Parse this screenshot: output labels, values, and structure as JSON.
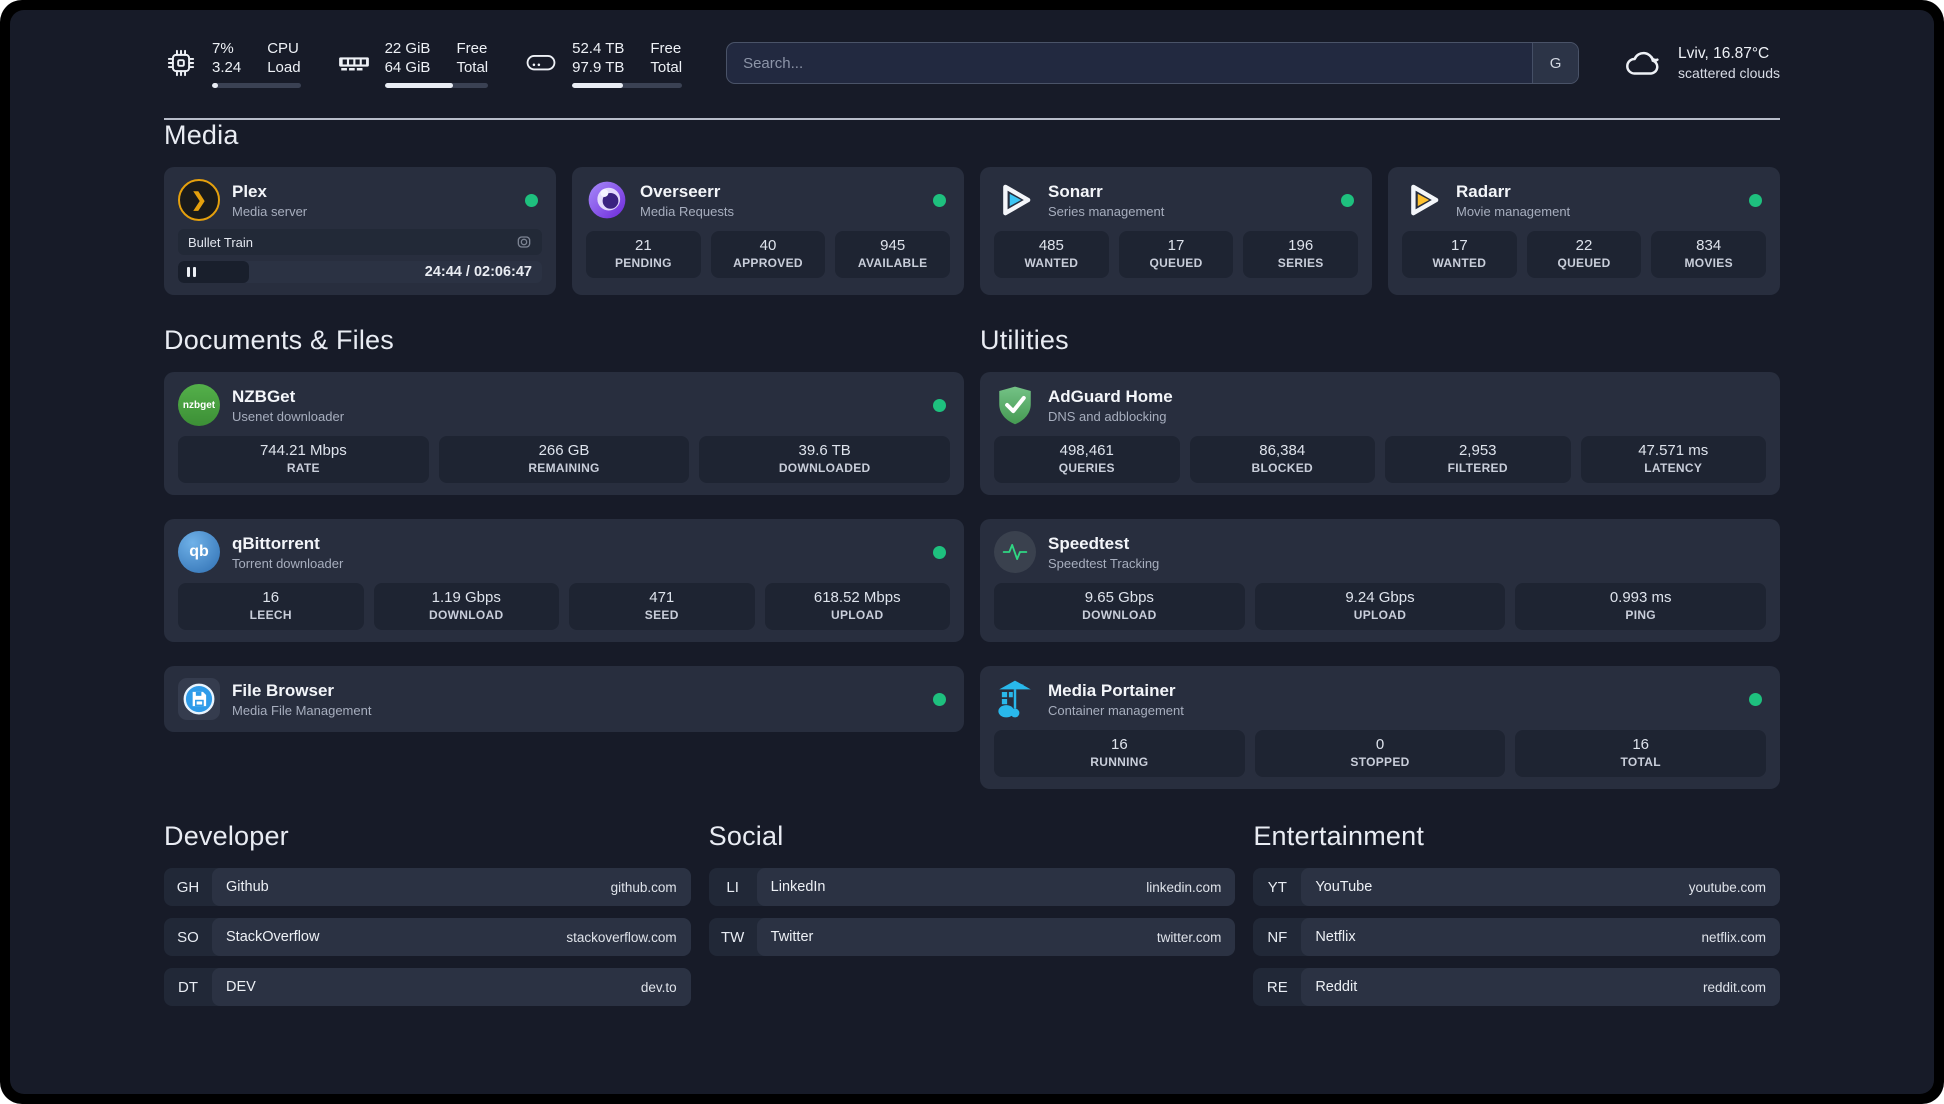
{
  "topbar": {
    "stats": [
      {
        "icon": "cpu-icon",
        "value1": "7%",
        "value2": "3.24",
        "label1": "CPU",
        "label2": "Load",
        "progress_pct": 7
      },
      {
        "icon": "ram-icon",
        "value1": "22 GiB",
        "value2": "64 GiB",
        "label1": "Free",
        "label2": "Total",
        "progress_pct": 66
      },
      {
        "icon": "disk-icon",
        "value1": "52.4 TB",
        "value2": "97.9 TB",
        "label1": "Free",
        "label2": "Total",
        "progress_pct": 46
      }
    ],
    "search": {
      "placeholder": "Search...",
      "engine_button": "G"
    },
    "weather": {
      "location_temp": "Lviv, 16.87°C",
      "condition": "scattered clouds"
    }
  },
  "media": {
    "title": "Media",
    "apps": [
      {
        "name": "Plex",
        "subtitle": "Media server",
        "online": true,
        "now_playing": {
          "title": "Bullet Train",
          "time": "24:44 / 02:06:47",
          "progress_pct": 19.5
        }
      },
      {
        "name": "Overseerr",
        "subtitle": "Media Requests",
        "online": true,
        "stats": [
          {
            "value": "21",
            "label": "PENDING"
          },
          {
            "value": "40",
            "label": "APPROVED"
          },
          {
            "value": "945",
            "label": "AVAILABLE"
          }
        ]
      },
      {
        "name": "Sonarr",
        "subtitle": "Series management",
        "online": true,
        "stats": [
          {
            "value": "485",
            "label": "WANTED"
          },
          {
            "value": "17",
            "label": "QUEUED"
          },
          {
            "value": "196",
            "label": "SERIES"
          }
        ]
      },
      {
        "name": "Radarr",
        "subtitle": "Movie management",
        "online": true,
        "stats": [
          {
            "value": "17",
            "label": "WANTED"
          },
          {
            "value": "22",
            "label": "QUEUED"
          },
          {
            "value": "834",
            "label": "MOVIES"
          }
        ]
      }
    ]
  },
  "documents": {
    "title": "Documents & Files",
    "apps": [
      {
        "name": "NZBGet",
        "subtitle": "Usenet downloader",
        "online": true,
        "icon_text": "nzbget",
        "stats": [
          {
            "value": "744.21 Mbps",
            "label": "RATE"
          },
          {
            "value": "266 GB",
            "label": "REMAINING"
          },
          {
            "value": "39.6 TB",
            "label": "DOWNLOADED"
          }
        ]
      },
      {
        "name": "qBittorrent",
        "subtitle": "Torrent downloader",
        "online": true,
        "icon_text": "qb",
        "stats": [
          {
            "value": "16",
            "label": "LEECH"
          },
          {
            "value": "1.19 Gbps",
            "label": "DOWNLOAD"
          },
          {
            "value": "471",
            "label": "SEED"
          },
          {
            "value": "618.52 Mbps",
            "label": "UPLOAD"
          }
        ]
      },
      {
        "name": "File Browser",
        "subtitle": "Media File Management",
        "online": true
      }
    ]
  },
  "utilities": {
    "title": "Utilities",
    "apps": [
      {
        "name": "AdGuard Home",
        "subtitle": "DNS and adblocking",
        "stats": [
          {
            "value": "498,461",
            "label": "QUERIES"
          },
          {
            "value": "86,384",
            "label": "BLOCKED"
          },
          {
            "value": "2,953",
            "label": "FILTERED"
          },
          {
            "value": "47.571 ms",
            "label": "LATENCY"
          }
        ]
      },
      {
        "name": "Speedtest",
        "subtitle": "Speedtest Tracking",
        "stats": [
          {
            "value": "9.65 Gbps",
            "label": "DOWNLOAD"
          },
          {
            "value": "9.24 Gbps",
            "label": "UPLOAD"
          },
          {
            "value": "0.993 ms",
            "label": "PING"
          }
        ]
      },
      {
        "name": "Media Portainer",
        "subtitle": "Container management",
        "online": true,
        "stats": [
          {
            "value": "16",
            "label": "RUNNING"
          },
          {
            "value": "0",
            "label": "STOPPED"
          },
          {
            "value": "16",
            "label": "TOTAL"
          }
        ]
      }
    ]
  },
  "bookmarks": [
    {
      "title": "Developer",
      "items": [
        {
          "prefix": "GH",
          "name": "Github",
          "domain": "github.com"
        },
        {
          "prefix": "SO",
          "name": "StackOverflow",
          "domain": "stackoverflow.com"
        },
        {
          "prefix": "DT",
          "name": "DEV",
          "domain": "dev.to"
        }
      ]
    },
    {
      "title": "Social",
      "items": [
        {
          "prefix": "LI",
          "name": "LinkedIn",
          "domain": "linkedin.com"
        },
        {
          "prefix": "TW",
          "name": "Twitter",
          "domain": "twitter.com"
        }
      ]
    },
    {
      "title": "Entertainment",
      "items": [
        {
          "prefix": "YT",
          "name": "YouTube",
          "domain": "youtube.com"
        },
        {
          "prefix": "NF",
          "name": "Netflix",
          "domain": "netflix.com"
        },
        {
          "prefix": "RE",
          "name": "Reddit",
          "domain": "reddit.com"
        }
      ]
    }
  ],
  "colors": {
    "background": "#171B28",
    "card": "#282E3E",
    "stat_tile": "#1E2432",
    "status_online": "#1EC07E",
    "plex_accent": "#E5A00D",
    "overseerr_accent": "#7C5CE8",
    "sonarr_accent": "#3BC5F4",
    "radarr_accent": "#FFC230",
    "nzbget_accent": "#44A53E",
    "qbittorrent_accent": "#3D7FC4",
    "adguard_accent": "#57B368",
    "speedtest_pulse": "#2FD783",
    "filebrowser_accent": "#2E9BE9",
    "portainer_accent": "#29B8EB"
  }
}
